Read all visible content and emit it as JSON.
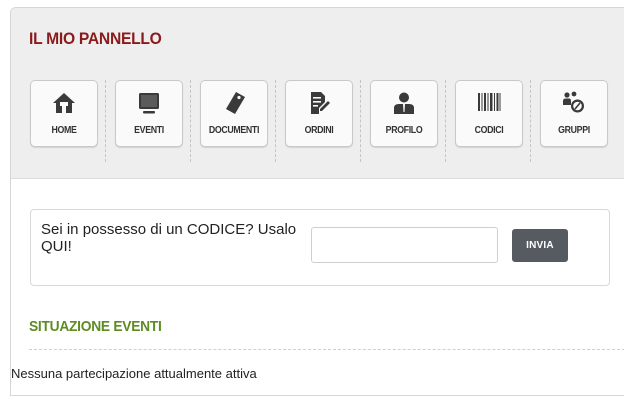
{
  "panel": {
    "title": "IL MIO PANNELLO"
  },
  "nav": [
    {
      "label": "HOME",
      "icon": "home-icon"
    },
    {
      "label": "EVENTI",
      "icon": "monitor-icon"
    },
    {
      "label": "DOCUMENTI",
      "icon": "tag-icon"
    },
    {
      "label": "ORDINI",
      "icon": "edit-document-icon"
    },
    {
      "label": "PROFILO",
      "icon": "user-icon"
    },
    {
      "label": "CODICI",
      "icon": "barcode-icon"
    },
    {
      "label": "GRUPPI",
      "icon": "group-icon"
    }
  ],
  "code": {
    "question": "Sei in possesso di un CODICE? Usalo QUI!",
    "input_value": "",
    "input_placeholder": "",
    "submit_label": "INVIA"
  },
  "events": {
    "title": "SITUAZIONE EVENTI",
    "message": "Nessuna partecipazione attualmente attiva"
  },
  "colors": {
    "title": "#8b1a1a",
    "section_title": "#5d8c22",
    "button": "#555b61",
    "icon": "#3a3a3a"
  }
}
